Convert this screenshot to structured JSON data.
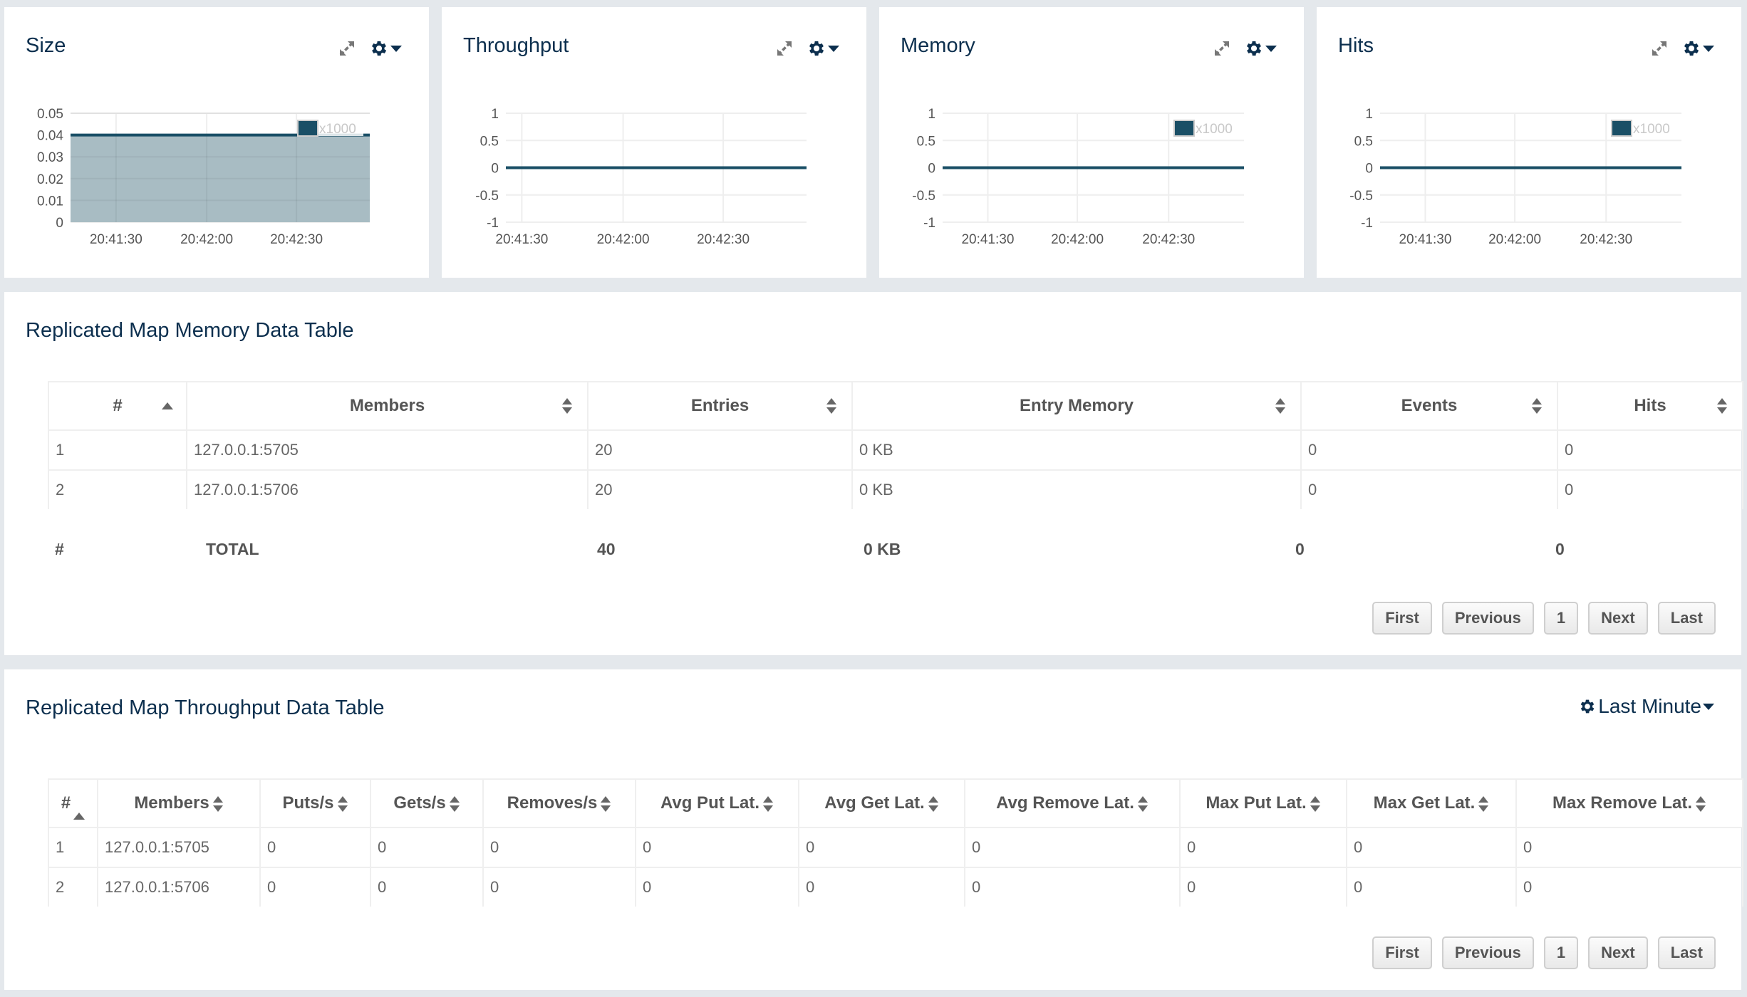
{
  "colors": {
    "title": "#0c2f4e",
    "series_line": "#1a4f66",
    "series_fill": "#a3b8c0",
    "grid": "#eeeeee",
    "page_bg": "#e4e8ec"
  },
  "chart_data": [
    {
      "type": "area",
      "title": "Size",
      "x": [
        "20:41:30",
        "20:42:00",
        "20:42:30"
      ],
      "xticks": [
        "20:41:30",
        "20:42:00",
        "20:42:30"
      ],
      "yticks": [
        "0",
        "0.01",
        "0.02",
        "0.03",
        "0.04",
        "0.05"
      ],
      "ylim": [
        0,
        0.05
      ],
      "grid": true,
      "legend": {
        "position": "top-right",
        "entries": [
          "x1000"
        ]
      },
      "series": [
        {
          "name": "x1000",
          "values": [
            0.04,
            0.04,
            0.04,
            0.04
          ]
        }
      ],
      "xlabel": "",
      "ylabel": ""
    },
    {
      "type": "line",
      "title": "Throughput",
      "x": [
        "20:41:30",
        "20:42:00",
        "20:42:30"
      ],
      "xticks": [
        "20:41:30",
        "20:42:00",
        "20:42:30"
      ],
      "yticks": [
        "-1",
        "-0.5",
        "0",
        "0.5",
        "1"
      ],
      "ylim": [
        -1,
        1
      ],
      "grid": true,
      "legend": null,
      "series": [
        {
          "name": "",
          "values": [
            0,
            0,
            0,
            0
          ]
        }
      ],
      "xlabel": "",
      "ylabel": ""
    },
    {
      "type": "line",
      "title": "Memory",
      "x": [
        "20:41:30",
        "20:42:00",
        "20:42:30"
      ],
      "xticks": [
        "20:41:30",
        "20:42:00",
        "20:42:30"
      ],
      "yticks": [
        "-1",
        "-0.5",
        "0",
        "0.5",
        "1"
      ],
      "ylim": [
        -1,
        1
      ],
      "grid": true,
      "legend": {
        "position": "top-right",
        "entries": [
          "x1000"
        ]
      },
      "series": [
        {
          "name": "x1000",
          "values": [
            0,
            0,
            0,
            0
          ]
        }
      ],
      "xlabel": "",
      "ylabel": ""
    },
    {
      "type": "line",
      "title": "Hits",
      "x": [
        "20:41:30",
        "20:42:00",
        "20:42:30"
      ],
      "xticks": [
        "20:41:30",
        "20:42:00",
        "20:42:30"
      ],
      "yticks": [
        "-1",
        "-0.5",
        "0",
        "0.5",
        "1"
      ],
      "ylim": [
        -1,
        1
      ],
      "grid": true,
      "legend": {
        "position": "top-right",
        "entries": [
          "x1000"
        ]
      },
      "series": [
        {
          "name": "x1000",
          "values": [
            0,
            0,
            0,
            0
          ]
        }
      ],
      "xlabel": "",
      "ylabel": ""
    }
  ],
  "charts": [
    {
      "title": "Size",
      "expand_icon": "expand-arrows-icon",
      "settings_icon": "gear-icon"
    },
    {
      "title": "Throughput",
      "expand_icon": "expand-arrows-icon",
      "settings_icon": "gear-icon"
    },
    {
      "title": "Memory",
      "expand_icon": "expand-arrows-icon",
      "settings_icon": "gear-icon"
    },
    {
      "title": "Hits",
      "expand_icon": "expand-arrows-icon",
      "settings_icon": "gear-icon"
    }
  ],
  "memory_table": {
    "title": "Replicated Map Memory Data Table",
    "columns": [
      "#",
      "Members",
      "Entries",
      "Entry Memory",
      "Events",
      "Hits"
    ],
    "rows": [
      [
        "1",
        "127.0.0.1:5705",
        "20",
        "0 KB",
        "0",
        "0"
      ],
      [
        "2",
        "127.0.0.1:5706",
        "20",
        "0 KB",
        "0",
        "0"
      ]
    ],
    "total": [
      "#",
      "TOTAL",
      "40",
      "0 KB",
      "0",
      "0"
    ],
    "pagination": {
      "first": "First",
      "previous": "Previous",
      "page": "1",
      "next": "Next",
      "last": "Last"
    }
  },
  "throughput_table": {
    "title": "Replicated Map Throughput Data Table",
    "range_selector": "Last Minute",
    "columns": [
      "#",
      "Members",
      "Puts/s",
      "Gets/s",
      "Removes/s",
      "Avg Put Lat.",
      "Avg Get Lat.",
      "Avg Remove Lat.",
      "Max Put Lat.",
      "Max Get Lat.",
      "Max Remove Lat."
    ],
    "rows": [
      [
        "1",
        "127.0.0.1:5705",
        "0",
        "0",
        "0",
        "0",
        "0",
        "0",
        "0",
        "0",
        "0"
      ],
      [
        "2",
        "127.0.0.1:5706",
        "0",
        "0",
        "0",
        "0",
        "0",
        "0",
        "0",
        "0",
        "0"
      ]
    ],
    "pagination": {
      "first": "First",
      "previous": "Previous",
      "page": "1",
      "next": "Next",
      "last": "Last"
    }
  }
}
